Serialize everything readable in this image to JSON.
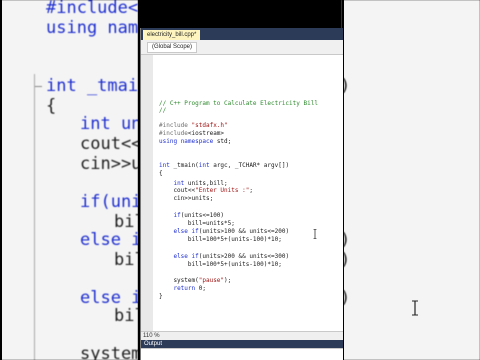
{
  "background": {
    "left_lines": [
      "#include<io",
      "using names",
      "int _tmain(",
      "{",
      "int units",
      "cout<<\"",
      "cin>>unit",
      "if(units",
      "bill",
      "else if(",
      "bill",
      "else if(",
      "bill",
      "system("
    ],
    "right_lines": [
      ")",
      ")",
      ")",
      ")"
    ]
  },
  "window": {
    "tab_title": "electricity_bill.cpp*",
    "scope": "(Global Scope)",
    "zoom": "110 %",
    "output_label": "Output"
  },
  "code": {
    "lines": [
      "// C++ Program to Calculate Electricity Bill",
      "//",
      "",
      "#include \"stdafx.h\"",
      "#include<iostream>",
      "using namespace std;",
      "",
      "",
      "int _tmain(int argc, _TCHAR* argv[])",
      "{",
      "    int units,bill;",
      "    cout<<\"Enter Units :\";",
      "    cin>>units;",
      "",
      "    if(units<=100)",
      "        bill=units*5;",
      "    else if(units>100 && units<=200)",
      "        bill=100*5+(units-100)*10;",
      "",
      "    else if(units>200 && units<=300)",
      "        bill=100*5+(units-100)*10;",
      "",
      "    system(\"pause\");",
      "    return 0;",
      "}"
    ]
  },
  "colors": {
    "keyword": "#1f2fd0",
    "comment": "#2f8a2f",
    "string": "#a31515",
    "tab_bar": "#2b3b58",
    "active_tab": "#fdf4bf"
  }
}
